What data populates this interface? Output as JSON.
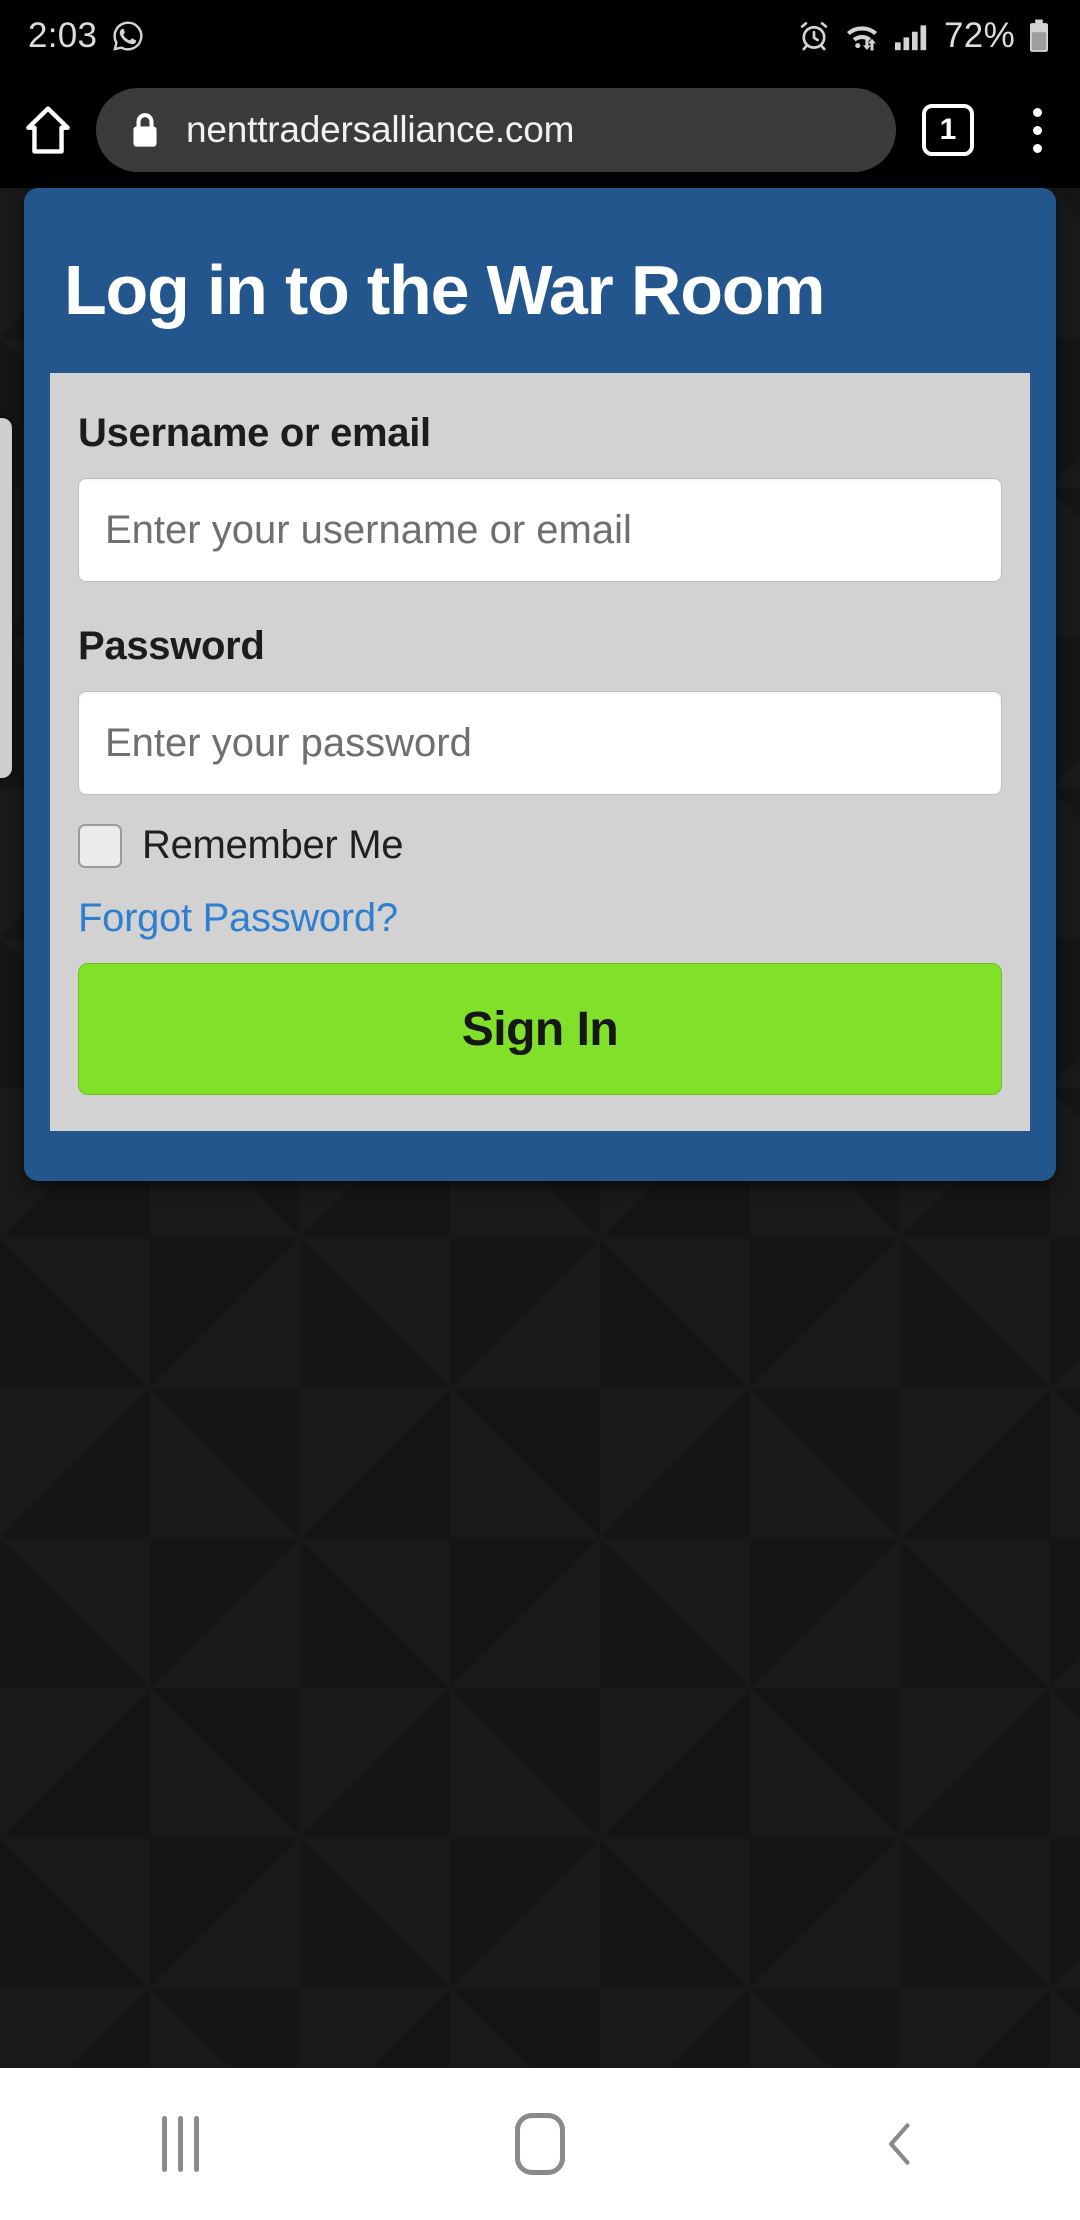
{
  "status_bar": {
    "time": "2:03",
    "battery_percent": "72%",
    "icons": [
      "whatsapp-icon",
      "alarm-icon",
      "wifi-icon",
      "signal-icon",
      "battery-icon"
    ]
  },
  "browser": {
    "url": "nenttradersalliance.com",
    "tab_count": "1",
    "icons": [
      "home-icon",
      "lock-icon",
      "tab-count-icon",
      "overflow-menu-icon"
    ]
  },
  "login_card": {
    "title": "Log in to the War Room",
    "username": {
      "label": "Username or email",
      "placeholder": "Enter your username or email",
      "value": ""
    },
    "password": {
      "label": "Password",
      "placeholder": "Enter your password",
      "value": ""
    },
    "remember_me": {
      "label": "Remember Me",
      "checked": false
    },
    "forgot_link": "Forgot Password?",
    "submit_label": "Sign In"
  },
  "nav_bar": {
    "recents_label": "Recents",
    "home_label": "Home",
    "back_label": "Back"
  },
  "colors": {
    "card_header": "#22568d",
    "form_panel": "#d2d2d2",
    "submit_green": "#80e02a",
    "link_blue": "#2f7fd1",
    "page_background": "#151515"
  }
}
